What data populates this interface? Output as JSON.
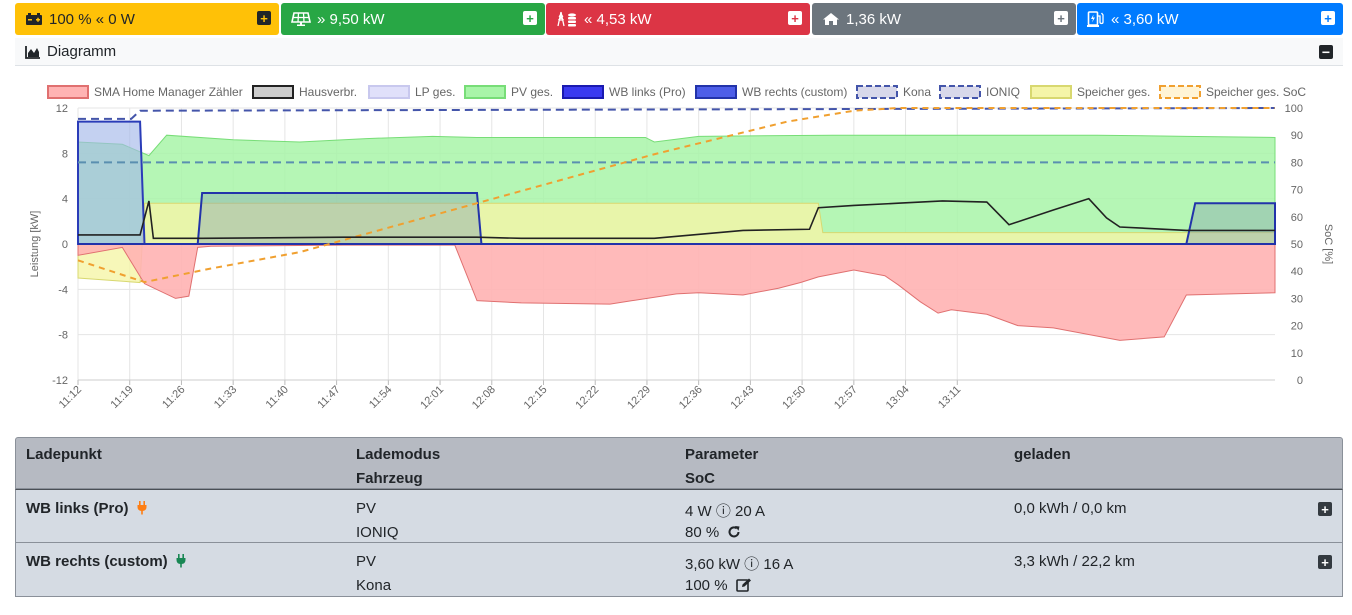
{
  "topbar": {
    "battery": {
      "value": "100 % « 0 W",
      "icon": "battery-icon",
      "color": "#ffc107"
    },
    "pv": {
      "value": "» 9,50 kW",
      "icon": "solar-panel-icon",
      "color": "#28a745"
    },
    "grid": {
      "value": "« 4,53 kW",
      "icon": "power-tower-icon",
      "color": "#dc3545"
    },
    "house": {
      "value": "1,36 kW",
      "icon": "home-icon",
      "color": "#6c757d"
    },
    "chargepoints": {
      "value": "« 3,60 kW",
      "icon": "charging-station-icon",
      "color": "#007bff"
    }
  },
  "diagram": {
    "title": "Diagramm",
    "icon": "area-chart-icon"
  },
  "chart_data": {
    "type": "area",
    "yleft": {
      "label": "Leistung [kW]",
      "ticks": [
        12,
        8,
        4,
        0,
        -4,
        -8,
        -12
      ],
      "range": [
        -12,
        12
      ]
    },
    "yright": {
      "label": "SoC [%]",
      "ticks": [
        100,
        90,
        80,
        70,
        60,
        50,
        40,
        30,
        20,
        10,
        0
      ],
      "range": [
        0,
        100
      ]
    },
    "xticks": [
      "11:12",
      "11:19",
      "11:26",
      "11:33",
      "11:40",
      "11:47",
      "11:54",
      "12:01",
      "12:08",
      "12:15",
      "12:22",
      "12:29",
      "12:36",
      "12:43",
      "12:50",
      "12:57",
      "13:04",
      "13:11"
    ],
    "grid": true,
    "legend_position": "top",
    "legend": [
      {
        "name": "SMA Home Manager Zähler",
        "fill": "#ffb3b3",
        "stroke": "#e07070",
        "dash": false
      },
      {
        "name": "Hausverbr.",
        "fill": "#cccccc",
        "stroke": "#222222",
        "dash": false
      },
      {
        "name": "LP ges.",
        "fill": "#e0e0fa",
        "stroke": "#c8c8ee",
        "dash": false
      },
      {
        "name": "PV ges.",
        "fill": "#a8f5a8",
        "stroke": "#77dd77",
        "dash": false
      },
      {
        "name": "WB links (Pro)",
        "fill": "#3a3af0",
        "stroke": "#1a1ab0",
        "dash": false
      },
      {
        "name": "WB rechts (custom)",
        "fill": "#4d5ee8",
        "stroke": "#2233aa",
        "dash": false
      },
      {
        "name": "Kona",
        "fill": "#d8d8ea",
        "stroke": "#4455aa",
        "dash": true
      },
      {
        "name": "IONIQ",
        "fill": "#d8d8ea",
        "stroke": "#4455aa",
        "dash": true
      },
      {
        "name": "Speicher ges.",
        "fill": "#f5f5a8",
        "stroke": "#d8d870",
        "dash": false
      },
      {
        "name": "Speicher ges. SoC",
        "fill": "#fff4d6",
        "stroke": "#f0a030",
        "dash": true
      }
    ],
    "series": {
      "grid_kw": [
        [
          11.2,
          -1.0
        ],
        [
          11.3,
          -0.3
        ],
        [
          11.35,
          -3.5
        ],
        [
          11.42,
          -4.8
        ],
        [
          11.45,
          -4.6
        ],
        [
          11.47,
          -0.3
        ],
        [
          11.5,
          -0.2
        ],
        [
          11.8,
          -0.1
        ],
        [
          12.05,
          -0.1
        ],
        [
          12.1,
          -5.0
        ],
        [
          12.2,
          -5.2
        ],
        [
          12.4,
          -5.3
        ],
        [
          12.45,
          -5.0
        ],
        [
          12.55,
          -4.4
        ],
        [
          12.6,
          -4.3
        ],
        [
          12.7,
          -4.5
        ],
        [
          12.78,
          -3.9
        ],
        [
          12.83,
          -3.4
        ],
        [
          12.87,
          -2.9
        ],
        [
          12.95,
          -2.3
        ],
        [
          13.02,
          -2.8
        ],
        [
          13.05,
          -3.6
        ],
        [
          13.1,
          -5.1
        ],
        [
          13.14,
          -6.1
        ],
        [
          13.17,
          -5.8
        ],
        [
          13.25,
          -6.2
        ],
        [
          13.32,
          -7.2
        ],
        [
          13.4,
          -7.4
        ],
        [
          13.55,
          -8.5
        ],
        [
          13.65,
          -8.2
        ],
        [
          13.7,
          -4.5
        ],
        [
          13.9,
          -4.3
        ]
      ],
      "pv_kw": [
        [
          11.2,
          9.0
        ],
        [
          11.3,
          8.8
        ],
        [
          11.33,
          8.3
        ],
        [
          11.36,
          7.8
        ],
        [
          11.4,
          9.6
        ],
        [
          11.55,
          9.2
        ],
        [
          11.7,
          9.0
        ],
        [
          11.85,
          9.3
        ],
        [
          12.0,
          9.5
        ],
        [
          12.1,
          9.4
        ],
        [
          12.2,
          9.4
        ],
        [
          12.3,
          9.4
        ],
        [
          12.4,
          9.4
        ],
        [
          12.48,
          9.4
        ],
        [
          12.5,
          9.0
        ],
        [
          12.6,
          9.5
        ],
        [
          12.9,
          9.6
        ],
        [
          13.2,
          9.6
        ],
        [
          13.5,
          9.6
        ],
        [
          13.7,
          9.5
        ],
        [
          13.9,
          9.4
        ]
      ],
      "house_kw": [
        [
          11.2,
          0.8
        ],
        [
          11.34,
          0.8
        ],
        [
          11.36,
          3.8
        ],
        [
          11.37,
          0.5
        ],
        [
          11.48,
          0.5
        ],
        [
          11.8,
          0.6
        ],
        [
          12.1,
          0.6
        ],
        [
          12.2,
          0.5
        ],
        [
          12.5,
          0.5
        ],
        [
          12.7,
          1.2
        ],
        [
          12.85,
          1.3
        ],
        [
          12.87,
          3.2
        ],
        [
          12.95,
          3.4
        ],
        [
          13.05,
          3.6
        ],
        [
          13.15,
          3.8
        ],
        [
          13.25,
          3.7
        ],
        [
          13.3,
          1.7
        ],
        [
          13.4,
          3.0
        ],
        [
          13.48,
          4.0
        ],
        [
          13.52,
          2.3
        ],
        [
          13.55,
          1.5
        ],
        [
          13.7,
          1.2
        ],
        [
          13.9,
          1.2
        ]
      ],
      "wb_links_kw": [
        [
          11.2,
          10.8
        ],
        [
          11.34,
          10.8
        ],
        [
          11.35,
          0
        ],
        [
          13.9,
          0
        ]
      ],
      "wb_rechts_kw": [
        [
          11.2,
          0
        ],
        [
          11.47,
          0
        ],
        [
          11.48,
          4.5
        ],
        [
          12.1,
          4.5
        ],
        [
          12.11,
          0
        ],
        [
          13.7,
          0
        ],
        [
          13.72,
          3.6
        ],
        [
          13.9,
          3.6
        ]
      ],
      "speicher_kw": [
        [
          11.2,
          -3.0
        ],
        [
          11.34,
          -3.4
        ],
        [
          11.35,
          3.6
        ],
        [
          12.87,
          3.6
        ],
        [
          12.88,
          1.0
        ],
        [
          13.9,
          1.0
        ]
      ],
      "speicher_soc_pct": [
        [
          11.2,
          44
        ],
        [
          11.35,
          36
        ],
        [
          11.5,
          41
        ],
        [
          11.7,
          47
        ],
        [
          11.9,
          56
        ],
        [
          12.1,
          65
        ],
        [
          12.3,
          74
        ],
        [
          12.5,
          83
        ],
        [
          12.65,
          89
        ],
        [
          12.8,
          95
        ],
        [
          12.95,
          99
        ],
        [
          13.05,
          100
        ],
        [
          13.9,
          100
        ]
      ],
      "kona_soc_pct": 80,
      "ioniq_soc_pct": 100
    }
  },
  "table": {
    "headers": {
      "col1": "Ladepunkt",
      "col2a": "Lademodus",
      "col2b": "Fahrzeug",
      "col3a": "Parameter",
      "col3b": "SoC",
      "col4": "geladen"
    },
    "rows": [
      {
        "name": "WB links (Pro)",
        "plug_icon": "plug-icon-orange",
        "mode": "PV",
        "vehicle": "IONIQ",
        "params": "4 W ⓘ 20 A",
        "soc": "80 %",
        "soc_icon": "refresh-icon",
        "charged": "0,0 kWh / 0,0 km"
      },
      {
        "name": "WB rechts (custom)",
        "plug_icon": "plug-icon-green",
        "mode": "PV",
        "vehicle": "Kona",
        "params": "3,60 kW ⓘ 16 A",
        "soc": "100 %",
        "soc_icon": "edit-icon",
        "charged": "3,3 kWh / 22,2 km"
      }
    ]
  }
}
